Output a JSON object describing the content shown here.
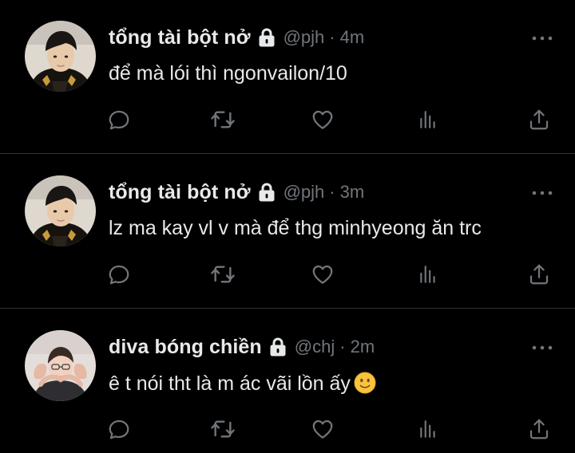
{
  "colors": {
    "background": "#000000",
    "text_primary": "#e7e9ea",
    "text_secondary": "#71767b",
    "divider": "#2f3336"
  },
  "tweets": [
    {
      "display_name": "tổng tài bột nở",
      "handle": "@pjh",
      "separator": "·",
      "time": "4m",
      "text": "để mà lói thì ngonvailon/10",
      "protected": true,
      "avatar": "avatar-pjh"
    },
    {
      "display_name": "tổng tài bột nở",
      "handle": "@pjh",
      "separator": "·",
      "time": "3m",
      "text": "lz ma kay vl v mà để thg minhyeong ăn trc",
      "protected": true,
      "avatar": "avatar-pjh"
    },
    {
      "display_name": "diva bóng chiền",
      "handle": "@chj",
      "separator": "·",
      "time": "2m",
      "text": "ê t nói tht là m ác vãi lồn ấy",
      "emoji": "slightly-smiling-face",
      "protected": true,
      "avatar": "avatar-chj"
    }
  ],
  "icons": {
    "reply": "reply-icon",
    "retweet": "retweet-icon",
    "like": "like-icon",
    "views": "views-icon",
    "share": "share-icon",
    "more": "more-icon",
    "lock": "lock-icon"
  }
}
